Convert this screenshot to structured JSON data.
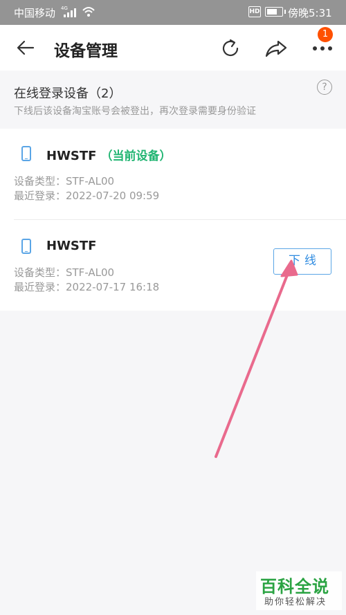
{
  "status_bar": {
    "carrier": "中国移动",
    "network": "4G",
    "hd": "HD",
    "battery_level": 0.7,
    "time": "傍晚5:31",
    "icons": [
      "signal-icon",
      "wifi-icon",
      "hd-icon",
      "battery-icon"
    ]
  },
  "nav": {
    "title": "设备管理",
    "back_icon": "arrow-left-icon",
    "refresh_icon": "refresh-icon",
    "share_icon": "share-icon",
    "more_icon": "more-icon",
    "more_badge": "1"
  },
  "section": {
    "heading": "在线登录设备（2）",
    "subtitle": "下线后该设备淘宝账号会被登出，再次登录需要身份验证",
    "help_icon": "question-icon",
    "help_label": "?"
  },
  "devices": [
    {
      "name": "HWSTF",
      "tag": "（当前设备）",
      "type": "设备类型：STF-AL00",
      "last_login": "最近登录：2022-07-20 09:59"
    },
    {
      "name": "HWSTF",
      "tag": "",
      "type": "设备类型：STF-AL00",
      "last_login": "最近登录：2022-07-17 16:18",
      "action_label": "下线"
    }
  ],
  "colors": {
    "accent_blue": "#2f8be0",
    "current_green": "#22b573",
    "badge_orange": "#ff5000",
    "annotation_pink": "#e96a8d",
    "watermark_green": "#2aa342"
  },
  "watermark": {
    "title": "百科全说",
    "subtitle": "助你轻松解决"
  }
}
